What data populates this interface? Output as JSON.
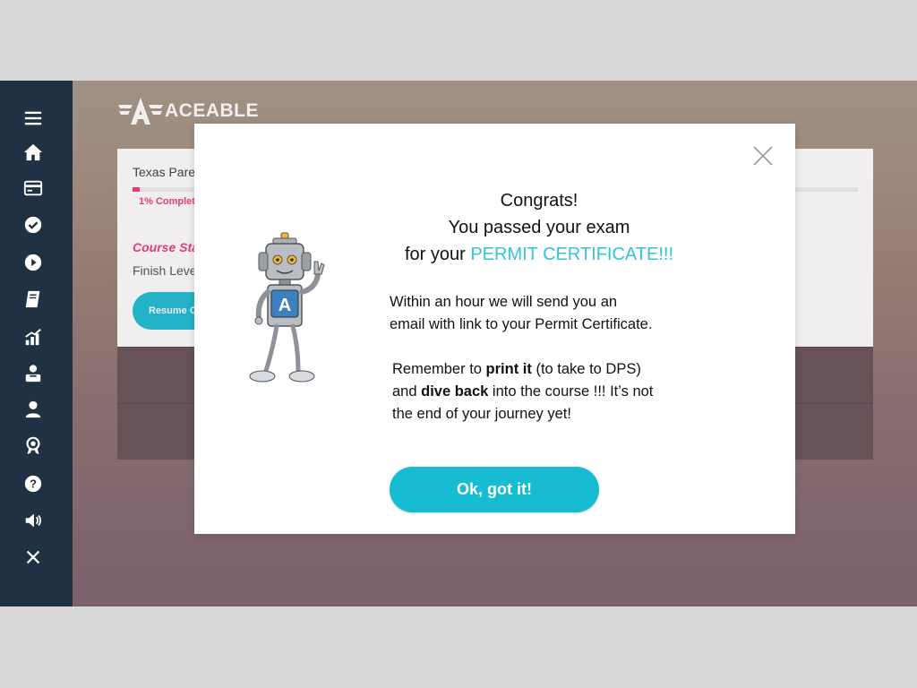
{
  "brand": {
    "name": "ACEABLE"
  },
  "sidebar": {
    "items": [
      {
        "icon": "menu-icon"
      },
      {
        "icon": "home-icon"
      },
      {
        "icon": "credit-card-icon"
      },
      {
        "icon": "check-circle-icon"
      },
      {
        "icon": "play-circle-icon"
      },
      {
        "icon": "book-icon"
      },
      {
        "icon": "bar-chart-icon"
      },
      {
        "icon": "student-icon"
      },
      {
        "icon": "user-icon"
      },
      {
        "icon": "award-icon"
      },
      {
        "icon": "help-icon"
      },
      {
        "icon": "volume-icon"
      },
      {
        "icon": "close-icon"
      }
    ]
  },
  "course": {
    "title": "Texas Parer",
    "progress_percent": 1,
    "progress_label": "1% Complete",
    "status": "Course Sta",
    "finish": "Finish Level",
    "resume_label": "Resume Co"
  },
  "modal": {
    "headline_line1": "Congrats!",
    "headline_line2": "You passed your exam",
    "headline_line3_prefix": "for your ",
    "headline_line3_highlight": "PERMIT CERTIFICATE!!!",
    "para1_line1": "Within an hour we will send you an",
    "para1_line2": "email with link to your Permit Certificate.",
    "para2_remember": "Remember to ",
    "para2_print": "print it",
    "para2_take": " (to take to DPS)",
    "para2_and": "and ",
    "para2_dive": "dive back",
    "para2_rest": " into the course !!! It’s not",
    "para2_line3": "the end of your journey yet!",
    "ok_label": "Ok, got it!"
  },
  "colors": {
    "sidebar": "#1f3142",
    "accent": "#17bcd2",
    "highlight": "#35c4d8",
    "pink": "#ee3f7f"
  }
}
